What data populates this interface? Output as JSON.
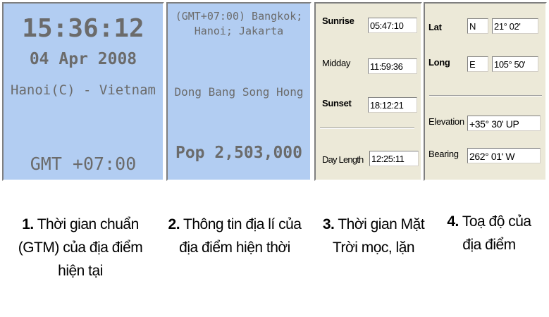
{
  "panel1": {
    "time": "15:36:12",
    "date": "04 Apr 2008",
    "location": "Hanoi(C) - Vietnam",
    "gmt": "GMT +07:00"
  },
  "panel2": {
    "timezone_line1": "(GMT+07:00) Bangkok;",
    "timezone_line2": "Hanoi; Jakarta",
    "region": "Dong Bang Song Hong",
    "population": "Pop 2,503,000"
  },
  "panel3": {
    "sunrise_label": "Sunrise",
    "sunrise_value": "05:47:10",
    "midday_label": "Midday",
    "midday_value": "11:59:36",
    "sunset_label": "Sunset",
    "sunset_value": "18:12:21",
    "daylength_label": "Day Length",
    "daylength_value": "12:25:11"
  },
  "panel4": {
    "lat_label": "Lat",
    "lat_dir": "N",
    "lat_value": "21° 02'",
    "long_label": "Long",
    "long_dir": "E",
    "long_value": "105° 50'",
    "elevation_label": "Elevation",
    "elevation_value": "+35° 30' UP",
    "bearing_label": "Bearing",
    "bearing_value": "262° 01' W"
  },
  "captions": [
    {
      "num": "1.",
      "lines": [
        "Thời gian chuẩn",
        "(GTM) của địa điểm",
        "hiện tại"
      ]
    },
    {
      "num": "2.",
      "lines": [
        "Thông tin địa lí của",
        "địa điểm hiện thời"
      ]
    },
    {
      "num": "3.",
      "lines": [
        "Thời gian Mặt",
        "Trời mọc, lặn"
      ]
    },
    {
      "num": "4.",
      "lines": [
        "Toạ độ của",
        "địa điểm"
      ]
    }
  ],
  "colors": {
    "panel_blue": "#b2cdf2",
    "panel_grey": "#ece9d8"
  }
}
